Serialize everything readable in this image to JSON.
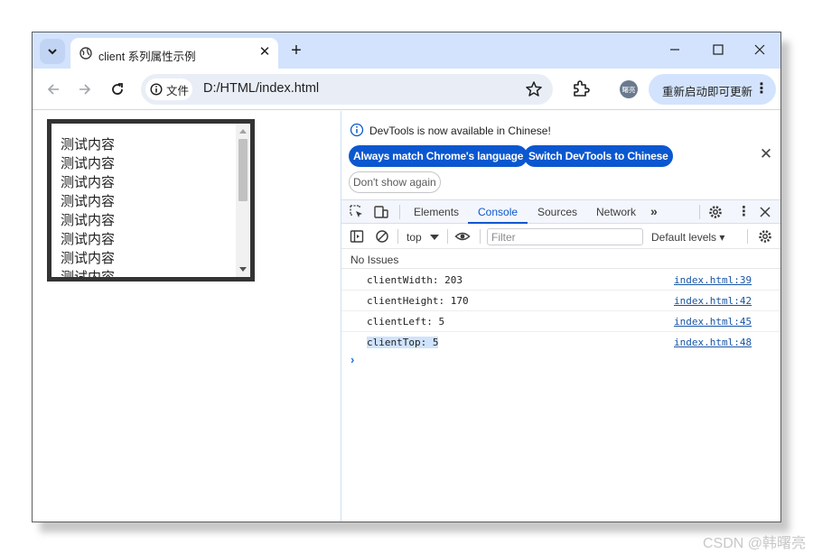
{
  "browser": {
    "tab_title": "client 系列属性示例",
    "address": "D:/HTML/index.html",
    "site_chip_label": "文件",
    "profile_initials": "曙亮",
    "update_button": "重新启动即可更新",
    "window_controls": [
      "minimize",
      "maximize",
      "close"
    ]
  },
  "page": {
    "lines": [
      "测试内容",
      "测试内容",
      "测试内容",
      "测试内容",
      "测试内容",
      "测试内容",
      "测试内容",
      "测试内容"
    ]
  },
  "devtools": {
    "notice": "DevTools is now available in Chinese!",
    "btn_match": "Always match Chrome's language",
    "btn_switch": "Switch DevTools to Chinese",
    "btn_dismiss": "Don't show again",
    "tabs": [
      "Elements",
      "Console",
      "Sources",
      "Network"
    ],
    "active_tab": "Console",
    "context": "top",
    "filter_placeholder": "Filter",
    "levels": "Default levels",
    "issues": "No Issues",
    "logs": [
      {
        "message": "clientWidth: 203",
        "source": "index.html:39",
        "selected": false
      },
      {
        "message": "clientHeight: 170",
        "source": "index.html:42",
        "selected": false
      },
      {
        "message": "clientLeft: 5",
        "source": "index.html:45",
        "selected": false
      },
      {
        "message": "clientTop: 5",
        "source": "index.html:48",
        "selected": true
      }
    ],
    "prompt_glyph": "›"
  },
  "watermark": "CSDN @韩曙亮",
  "colors": {
    "titlebar": "#d3e3fd",
    "accent": "#0b57d0",
    "selection": "#cfe3fc"
  }
}
